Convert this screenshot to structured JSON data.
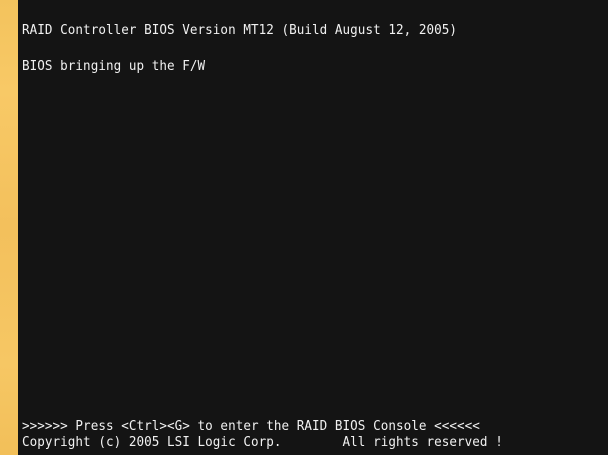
{
  "boot_screen": {
    "title": "RAID Controller BIOS Version MT12 (Build August 12, 2005)",
    "status": "BIOS bringing up the F/W",
    "prompt": ">>>>>> Press <Ctrl><G> to enter the RAID BIOS Console <<<<<<",
    "copyright": "Copyright (c) 2005 LSI Logic Corp.        All rights reserved !"
  },
  "colors": {
    "background": "#141414",
    "text": "#f1f1f1",
    "left_accent": "#f3c35d"
  }
}
